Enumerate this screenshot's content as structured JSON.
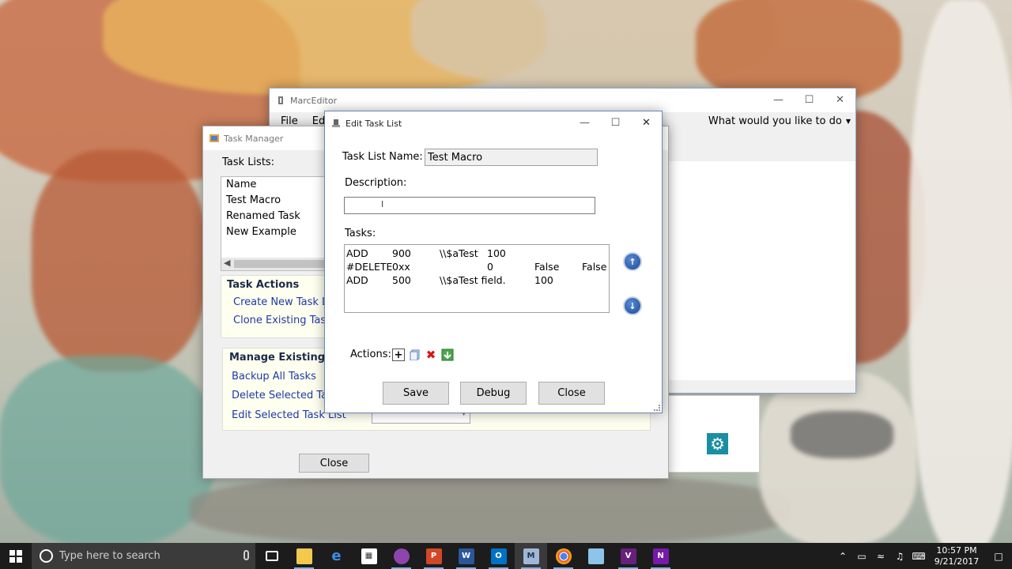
{
  "marc_editor": {
    "title": "MarcEditor",
    "menu": [
      "File",
      "Edi"
    ],
    "tell_me": "What would you like to do"
  },
  "task_manager": {
    "title": "Task Manager",
    "task_lists_label": "Task Lists:",
    "list_items": [
      "Name",
      "Test Macro",
      "Renamed Task",
      "New Example"
    ],
    "task_actions_heading": "Task Actions",
    "create_new": "Create New Task List",
    "clone_existing": "Clone Existing Task L",
    "manage_heading": "Manage Existing Ta",
    "backup_all": "Backup All Tasks",
    "delete_selected": "Delete Selected Task",
    "edit_selected": "Edit Selected Task List",
    "close_label": "Close"
  },
  "edit_task_list": {
    "title": "Edit Task List",
    "name_label": "Task List Name:",
    "name_value": "Test Macro",
    "description_label": "Description:",
    "description_value": "",
    "tasks_label": "Tasks:",
    "tasks": [
      [
        "ADD",
        "900",
        "\\\\$aTest",
        "100",
        "",
        ""
      ],
      [
        "#DELETE",
        "0xx",
        "",
        "0",
        "False",
        "False"
      ],
      [
        "ADD",
        "500",
        "\\\\$aTest field.",
        "100",
        "",
        ""
      ]
    ],
    "actions_label": "Actions:",
    "save_label": "Save",
    "debug_label": "Debug",
    "close_label": "Close"
  },
  "taskbar": {
    "search_placeholder": "Type here to search",
    "time": "10:57 PM",
    "date": "9/21/2017"
  },
  "icons": {
    "start": "windows-logo",
    "search": "cortana-circle",
    "up": "arrow-up-circle",
    "down": "arrow-down-circle",
    "add": "add-icon",
    "copy": "copy-icon",
    "delete": "delete-icon",
    "import": "import-icon",
    "gear": "gear-icon"
  },
  "colors": {
    "link": "#1c3aa9",
    "taskbar": "#1c1c1c",
    "accent_teal": "#1a8fa2",
    "round_button": "#1b4b97"
  }
}
